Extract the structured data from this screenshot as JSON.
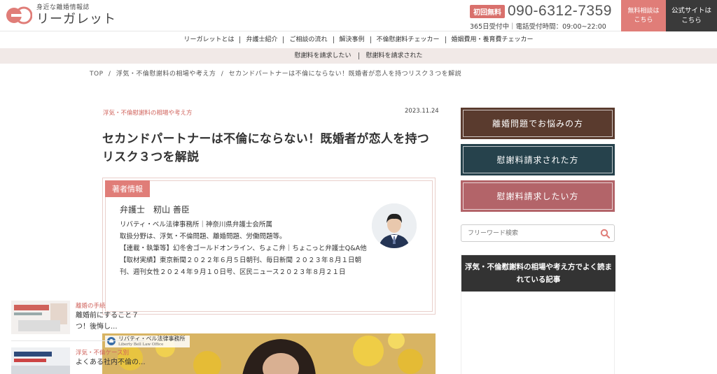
{
  "header": {
    "logo_tagline": "身近な離婚情報誌",
    "logo_name": "リーガレット",
    "first_badge": "初回無料",
    "phone": "090-6312-7359",
    "hours": "365日受付中｜電話受付時間：09:00~22:00",
    "consult_line1": "無料相談は",
    "consult_line2": "こちら",
    "official_line1": "公式サイトは",
    "official_line2": "こちら"
  },
  "nav": {
    "primary": [
      "リーガレットとは",
      "弁護士紹介",
      "ご相談の流れ",
      "解決事例",
      "不倫慰謝料チェッカー",
      "婚姻費用・養育費チェッカー"
    ],
    "secondary": [
      "慰謝料を請求したい",
      "慰謝料を請求された"
    ]
  },
  "breadcrumb": [
    "TOP",
    "/",
    "浮気・不倫慰謝料の相場や考え方",
    "/",
    "セカンドパートナーは不倫にならない！既婚者が恋人を持つリスク３つを解説"
  ],
  "article": {
    "category": "浮気・不倫慰謝料の相場や考え方",
    "date": "2023.11.24",
    "title": "セカンドパートナーは不倫にならない！既婚者が恋人を持つリスク３つを解説",
    "author_badge": "著者情報",
    "author_name": "弁護士　籾山 善臣",
    "author_lines": [
      "リバティ・ベル法律事務所｜神奈川県弁護士会所属",
      "取扱分野は、浮気・不倫問題、離婚問題、労働問題等。",
      "【連載・執筆等】幻冬舎ゴールドオンライン、ちょこ弁｜ちょこっと弁護士Q&A他",
      "【取材実績】東京新聞２０２２年６月５日朝刊、毎日新聞 ２０２３年８月１日朝刊、週刊女性２０２４年９月１０日号、区民ニュース２０２３年８月２１日"
    ],
    "hero_label": "リバティ・ベル法律事務所",
    "hero_sub": "Liberty Bell Law Office"
  },
  "sidebar": {
    "buttons": [
      "離婚問題でお悩みの方",
      "慰謝料請求された方",
      "慰謝料請求したい方"
    ],
    "search_placeholder": "フリーワード検索",
    "popular_title": "浮気・不倫慰謝料の相場や考え方でよく読まれている記事",
    "popular_items": [
      {
        "category": "離婚の手続",
        "title": "離婚前にすること７つ！後悔し..."
      },
      {
        "category": "浮気・不倫ケース別",
        "title": "よくある社内不倫の..."
      }
    ]
  },
  "colors": {
    "accent": "#e07d78",
    "btn_brown": "#5a3b2e",
    "btn_teal": "#26424c",
    "btn_rose": "#b36469",
    "dark": "#3a3a3a"
  }
}
